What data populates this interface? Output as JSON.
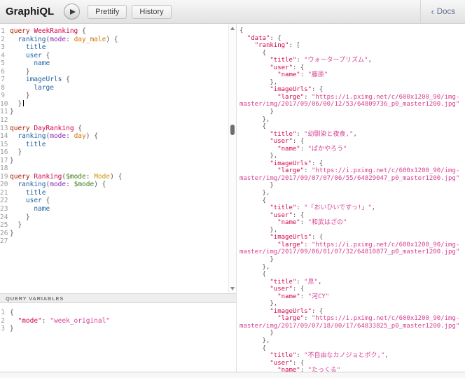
{
  "toolbar": {
    "title": "GraphiQL",
    "prettify_label": "Prettify",
    "history_label": "History",
    "docs_chevron": "‹",
    "docs_label": "Docs"
  },
  "variables_header": "QUERY VARIABLES",
  "syntax_colors": {
    "keyword": "#B11A04",
    "definition": "#D2054E",
    "field": "#1F61A0",
    "argument": "#8B2BB9",
    "enum": "#D47509",
    "variable": "#397D13",
    "type": "#CA9800",
    "punctuation": "#555555",
    "result_key": "#D2054E",
    "string": "#D64292",
    "line_number": "#999999"
  },
  "editors": {
    "query": {
      "lines": [
        [
          [
            "kw",
            "query"
          ],
          [
            "ws",
            " "
          ],
          [
            "def",
            "WeekRanking"
          ],
          [
            "pn",
            " {"
          ]
        ],
        [
          [
            "ws",
            "  "
          ],
          [
            "prop",
            "ranking"
          ],
          [
            "pn",
            "("
          ],
          [
            "attr",
            "mode"
          ],
          [
            "pn",
            ": "
          ],
          [
            "enum",
            "day_male"
          ],
          [
            "pn",
            ") {"
          ]
        ],
        [
          [
            "ws",
            "    "
          ],
          [
            "prop",
            "title"
          ]
        ],
        [
          [
            "ws",
            "    "
          ],
          [
            "prop",
            "user"
          ],
          [
            "pn",
            " {"
          ]
        ],
        [
          [
            "ws",
            "      "
          ],
          [
            "prop",
            "name"
          ]
        ],
        [
          [
            "ws",
            "    "
          ],
          [
            "pn",
            "}"
          ]
        ],
        [
          [
            "ws",
            "    "
          ],
          [
            "prop",
            "imageUrls"
          ],
          [
            "pn",
            " {"
          ]
        ],
        [
          [
            "ws",
            "      "
          ],
          [
            "prop",
            "large"
          ]
        ],
        [
          [
            "ws",
            "    "
          ],
          [
            "pn",
            "}"
          ]
        ],
        [
          [
            "ws",
            "  "
          ],
          [
            "pn",
            "}"
          ],
          [
            "cursor",
            ""
          ]
        ],
        [
          [
            "pn",
            "}"
          ]
        ],
        [],
        [
          [
            "kw",
            "query"
          ],
          [
            "ws",
            " "
          ],
          [
            "def",
            "DayRanking"
          ],
          [
            "pn",
            " {"
          ]
        ],
        [
          [
            "ws",
            "  "
          ],
          [
            "prop",
            "ranking"
          ],
          [
            "pn",
            "("
          ],
          [
            "attr",
            "mode"
          ],
          [
            "pn",
            ": "
          ],
          [
            "enum",
            "day"
          ],
          [
            "pn",
            ") {"
          ]
        ],
        [
          [
            "ws",
            "    "
          ],
          [
            "prop",
            "title"
          ]
        ],
        [
          [
            "ws",
            "  "
          ],
          [
            "pn",
            "}"
          ]
        ],
        [
          [
            "pn",
            "}"
          ]
        ],
        [],
        [
          [
            "kw",
            "query"
          ],
          [
            "ws",
            " "
          ],
          [
            "def",
            "Ranking"
          ],
          [
            "pn",
            "("
          ],
          [
            "var",
            "$mode"
          ],
          [
            "pn",
            ": "
          ],
          [
            "atom",
            "Mode"
          ],
          [
            "pn",
            ") {"
          ]
        ],
        [
          [
            "ws",
            "  "
          ],
          [
            "prop",
            "ranking"
          ],
          [
            "pn",
            "("
          ],
          [
            "attr",
            "mode"
          ],
          [
            "pn",
            ": "
          ],
          [
            "var",
            "$mode"
          ],
          [
            "pn",
            ") {"
          ]
        ],
        [
          [
            "ws",
            "    "
          ],
          [
            "prop",
            "title"
          ]
        ],
        [
          [
            "ws",
            "    "
          ],
          [
            "prop",
            "user"
          ],
          [
            "pn",
            " {"
          ]
        ],
        [
          [
            "ws",
            "      "
          ],
          [
            "prop",
            "name"
          ]
        ],
        [
          [
            "ws",
            "    "
          ],
          [
            "pn",
            "}"
          ]
        ],
        [
          [
            "ws",
            "  "
          ],
          [
            "pn",
            "}"
          ]
        ],
        [
          [
            "pn",
            "}"
          ]
        ],
        []
      ]
    },
    "variables": {
      "lines": [
        [
          [
            "pn",
            "{"
          ]
        ],
        [
          [
            "ws",
            "  "
          ],
          [
            "key",
            "\"mode\""
          ],
          [
            "pn",
            ": "
          ],
          [
            "str",
            "\"week_original\""
          ]
        ],
        [
          [
            "pn",
            "}"
          ]
        ]
      ]
    },
    "result": {
      "lines": [
        [
          [
            "pn",
            "{"
          ]
        ],
        [
          [
            "ws",
            "  "
          ],
          [
            "key",
            "\"data\""
          ],
          [
            "pn",
            ": {"
          ]
        ],
        [
          [
            "ws",
            "    "
          ],
          [
            "key",
            "\"ranking\""
          ],
          [
            "pn",
            ": ["
          ]
        ],
        [
          [
            "ws",
            "      "
          ],
          [
            "pn",
            "{"
          ]
        ],
        [
          [
            "ws",
            "        "
          ],
          [
            "key",
            "\"title\""
          ],
          [
            "pn",
            ": "
          ],
          [
            "str",
            "\"ウォータープリズム\""
          ],
          [
            "pn",
            ","
          ]
        ],
        [
          [
            "ws",
            "        "
          ],
          [
            "key",
            "\"user\""
          ],
          [
            "pn",
            ": {"
          ]
        ],
        [
          [
            "ws",
            "          "
          ],
          [
            "key",
            "\"name\""
          ],
          [
            "pn",
            ": "
          ],
          [
            "str",
            "\"藤原\""
          ]
        ],
        [
          [
            "ws",
            "        "
          ],
          [
            "pn",
            "},"
          ]
        ],
        [
          [
            "ws",
            "        "
          ],
          [
            "key",
            "\"imageUrls\""
          ],
          [
            "pn",
            ": {"
          ]
        ],
        [
          [
            "ws",
            "          "
          ],
          [
            "key",
            "\"large\""
          ],
          [
            "pn",
            ": "
          ],
          [
            "str",
            "\"https://i.pximg.net/c/600x1200_90/img-"
          ]
        ],
        [
          [
            "str",
            "master/img/2017/09/06/00/12/53/64809736_p0_master1200.jpg\""
          ]
        ],
        [
          [
            "ws",
            "        "
          ],
          [
            "pn",
            "}"
          ]
        ],
        [
          [
            "ws",
            "      "
          ],
          [
            "pn",
            "},"
          ]
        ],
        [
          [
            "ws",
            "      "
          ],
          [
            "pn",
            "{"
          ]
        ],
        [
          [
            "ws",
            "        "
          ],
          [
            "key",
            "\"title\""
          ],
          [
            "pn",
            ": "
          ],
          [
            "str",
            "\"幼馴染と夜食,\""
          ],
          [
            "pn",
            ","
          ]
        ],
        [
          [
            "ws",
            "        "
          ],
          [
            "key",
            "\"user\""
          ],
          [
            "pn",
            ": {"
          ]
        ],
        [
          [
            "ws",
            "          "
          ],
          [
            "key",
            "\"name\""
          ],
          [
            "pn",
            ": "
          ],
          [
            "str",
            "\"ばかやろう\""
          ]
        ],
        [
          [
            "ws",
            "        "
          ],
          [
            "pn",
            "},"
          ]
        ],
        [
          [
            "ws",
            "        "
          ],
          [
            "key",
            "\"imageUrls\""
          ],
          [
            "pn",
            ": {"
          ]
        ],
        [
          [
            "ws",
            "          "
          ],
          [
            "key",
            "\"large\""
          ],
          [
            "pn",
            ": "
          ],
          [
            "str",
            "\"https://i.pximg.net/c/600x1200_90/img-"
          ]
        ],
        [
          [
            "str",
            "master/img/2017/09/07/07/06/55/64829047_p0_master1200.jpg\""
          ]
        ],
        [
          [
            "ws",
            "        "
          ],
          [
            "pn",
            "}"
          ]
        ],
        [
          [
            "ws",
            "      "
          ],
          [
            "pn",
            "},"
          ]
        ],
        [
          [
            "ws",
            "      "
          ],
          [
            "pn",
            "{"
          ]
        ],
        [
          [
            "ws",
            "        "
          ],
          [
            "key",
            "\"title\""
          ],
          [
            "pn",
            ": "
          ],
          [
            "str",
            "\"「おいひいですっ!」\""
          ],
          [
            "pn",
            ","
          ]
        ],
        [
          [
            "ws",
            "        "
          ],
          [
            "key",
            "\"user\""
          ],
          [
            "pn",
            ": {"
          ]
        ],
        [
          [
            "ws",
            "          "
          ],
          [
            "key",
            "\"name\""
          ],
          [
            "pn",
            ": "
          ],
          [
            "str",
            "\"和武はざの\""
          ]
        ],
        [
          [
            "ws",
            "        "
          ],
          [
            "pn",
            "},"
          ]
        ],
        [
          [
            "ws",
            "        "
          ],
          [
            "key",
            "\"imageUrls\""
          ],
          [
            "pn",
            ": {"
          ]
        ],
        [
          [
            "ws",
            "          "
          ],
          [
            "key",
            "\"large\""
          ],
          [
            "pn",
            ": "
          ],
          [
            "str",
            "\"https://i.pximg.net/c/600x1200_90/img-"
          ]
        ],
        [
          [
            "str",
            "master/img/2017/09/06/01/07/32/64810877_p0_master1200.jpg\""
          ]
        ],
        [
          [
            "ws",
            "        "
          ],
          [
            "pn",
            "}"
          ]
        ],
        [
          [
            "ws",
            "      "
          ],
          [
            "pn",
            "},"
          ]
        ],
        [
          [
            "ws",
            "      "
          ],
          [
            "pn",
            "{"
          ]
        ],
        [
          [
            "ws",
            "        "
          ],
          [
            "key",
            "\"title\""
          ],
          [
            "pn",
            ": "
          ],
          [
            "str",
            "\"息\""
          ],
          [
            "pn",
            ","
          ]
        ],
        [
          [
            "ws",
            "        "
          ],
          [
            "key",
            "\"user\""
          ],
          [
            "pn",
            ": {"
          ]
        ],
        [
          [
            "ws",
            "          "
          ],
          [
            "key",
            "\"name\""
          ],
          [
            "pn",
            ": "
          ],
          [
            "str",
            "\"河CY\""
          ]
        ],
        [
          [
            "ws",
            "        "
          ],
          [
            "pn",
            "},"
          ]
        ],
        [
          [
            "ws",
            "        "
          ],
          [
            "key",
            "\"imageUrls\""
          ],
          [
            "pn",
            ": {"
          ]
        ],
        [
          [
            "ws",
            "          "
          ],
          [
            "key",
            "\"large\""
          ],
          [
            "pn",
            ": "
          ],
          [
            "str",
            "\"https://i.pximg.net/c/600x1200_90/img-"
          ]
        ],
        [
          [
            "str",
            "master/img/2017/09/07/18/00/17/64833825_p0_master1200.jpg\""
          ]
        ],
        [
          [
            "ws",
            "        "
          ],
          [
            "pn",
            "}"
          ]
        ],
        [
          [
            "ws",
            "      "
          ],
          [
            "pn",
            "},"
          ]
        ],
        [
          [
            "ws",
            "      "
          ],
          [
            "pn",
            "{"
          ]
        ],
        [
          [
            "ws",
            "        "
          ],
          [
            "key",
            "\"title\""
          ],
          [
            "pn",
            ": "
          ],
          [
            "str",
            "\"不自由なカノジョとボク,\""
          ],
          [
            "pn",
            ","
          ]
        ],
        [
          [
            "ws",
            "        "
          ],
          [
            "key",
            "\"user\""
          ],
          [
            "pn",
            ": {"
          ]
        ],
        [
          [
            "ws",
            "          "
          ],
          [
            "key",
            "\"name\""
          ],
          [
            "pn",
            ": "
          ],
          [
            "str",
            "\"たっくる\""
          ]
        ]
      ]
    }
  }
}
